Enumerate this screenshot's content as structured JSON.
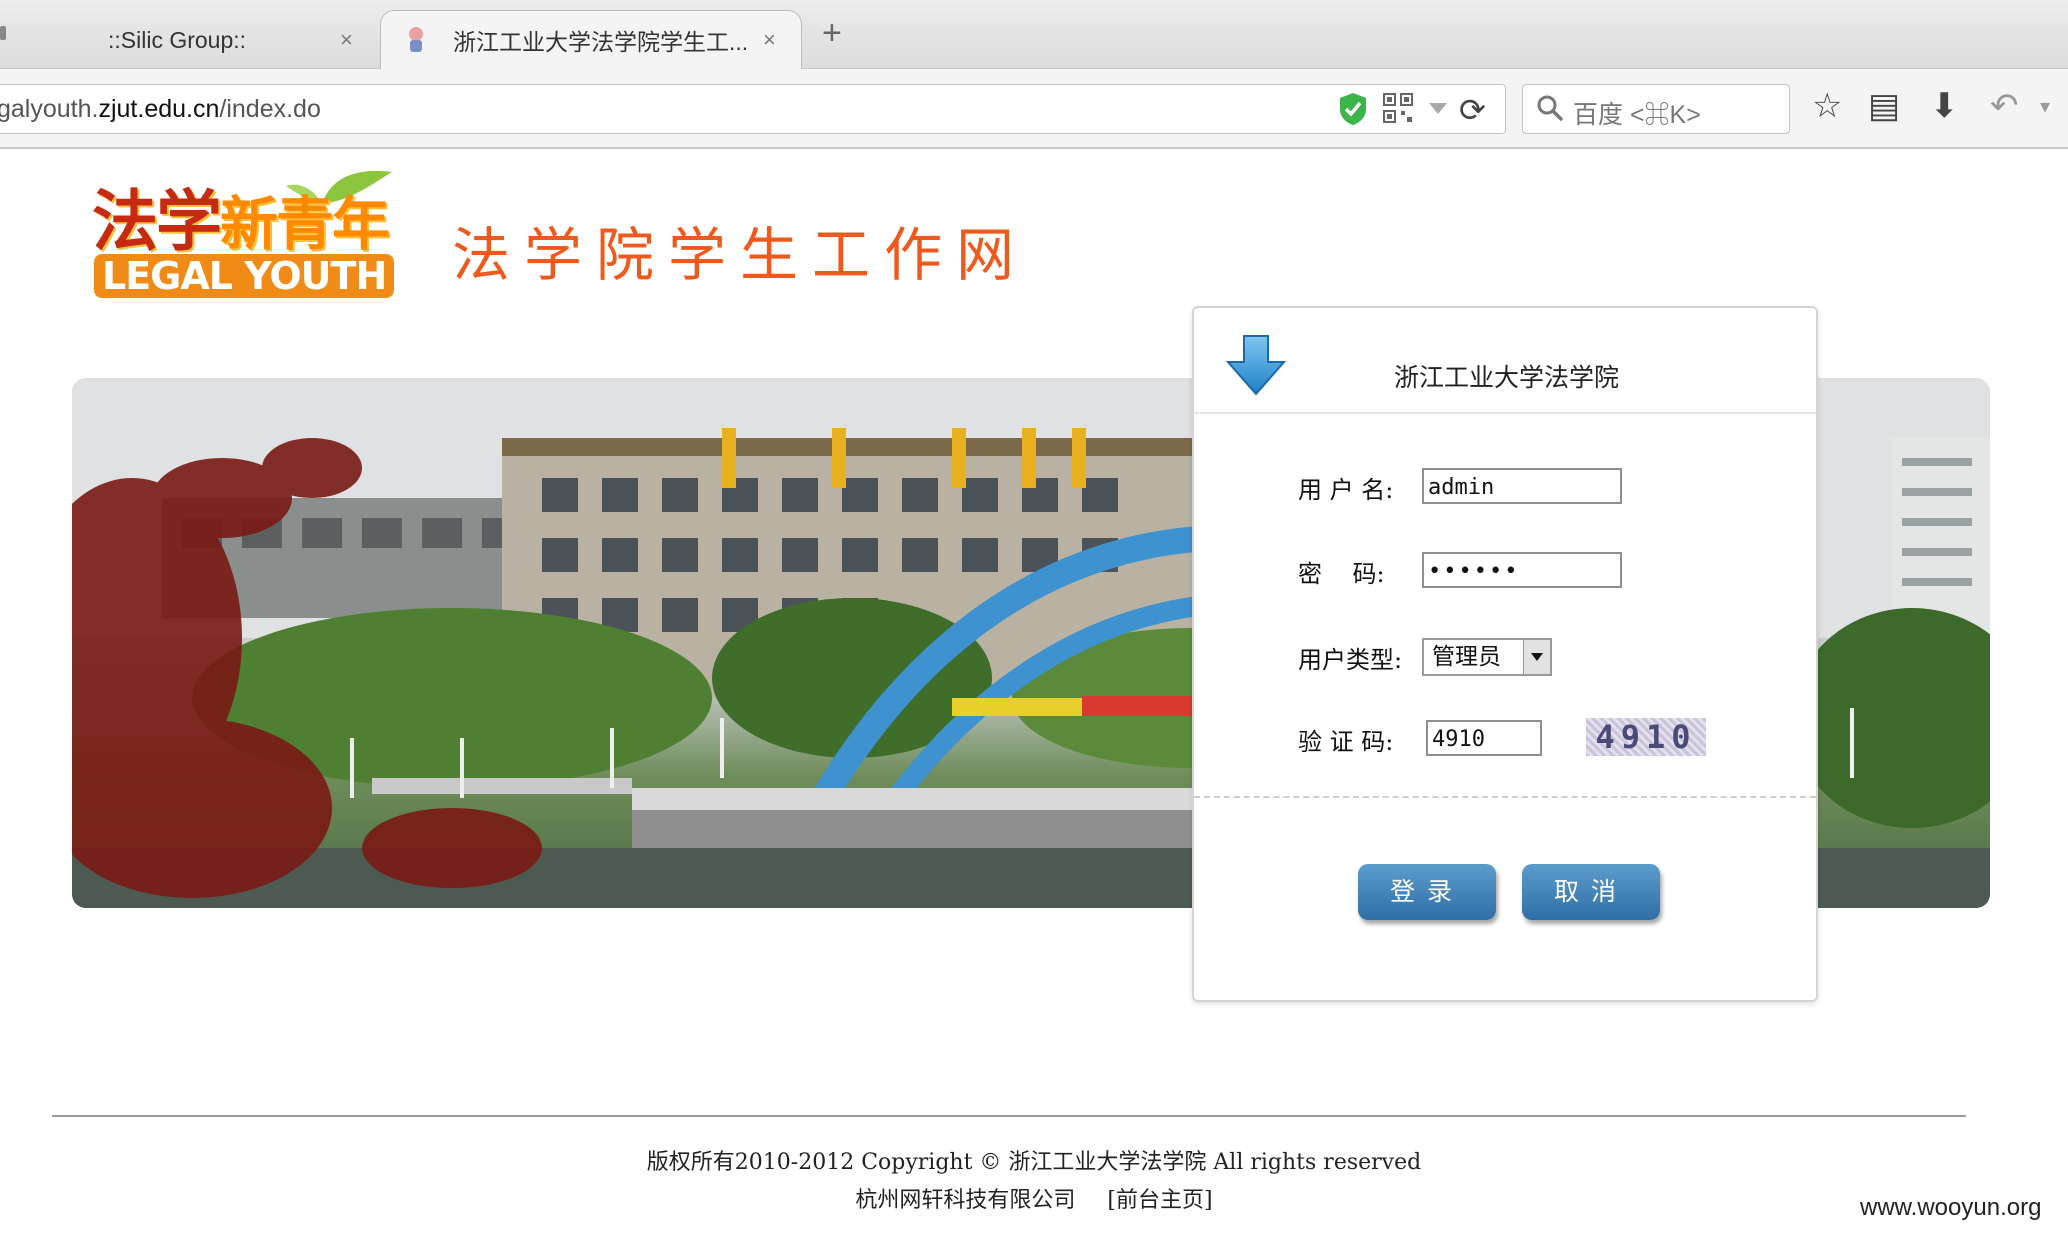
{
  "browser": {
    "tabs": [
      {
        "title": "::Silic Group::",
        "active": false
      },
      {
        "title": "浙江工业大学法学院学生工...",
        "active": true
      }
    ],
    "close_glyph": "×",
    "new_tab_glyph": "+",
    "url": {
      "prefix": "galyouth.",
      "host": "zjut.edu.cn",
      "path": "/index.do"
    },
    "search_placeholder": "百度 <⌘K>"
  },
  "header": {
    "logo_cn": "法学",
    "logo_cn_accent": "新青年",
    "logo_en": "LEGAL YOUTH",
    "site_title": "法学院学生工作网"
  },
  "login": {
    "title": "浙江工业大学法学院",
    "username_label": "用 户 名:",
    "username_value": "admin",
    "password_label": "密    码:",
    "password_value": "••••••",
    "usertype_label": "用户类型:",
    "usertype_value": "管理员",
    "captcha_label": "验 证 码:",
    "captcha_input": "4910",
    "captcha_image_text": "4910",
    "login_button": "登录",
    "cancel_button": "取消"
  },
  "footer": {
    "copyright": "版权所有2010-2012 Copyright © 浙江工业大学法学院 All rights reserved",
    "company": "杭州网轩科技有限公司",
    "home_link": "[前台主页]"
  },
  "watermark": "www.wooyun.org",
  "colors": {
    "accent_orange": "#ee5a1e",
    "button_blue": "#2f6fa6",
    "logo_red": "#c72a10"
  }
}
